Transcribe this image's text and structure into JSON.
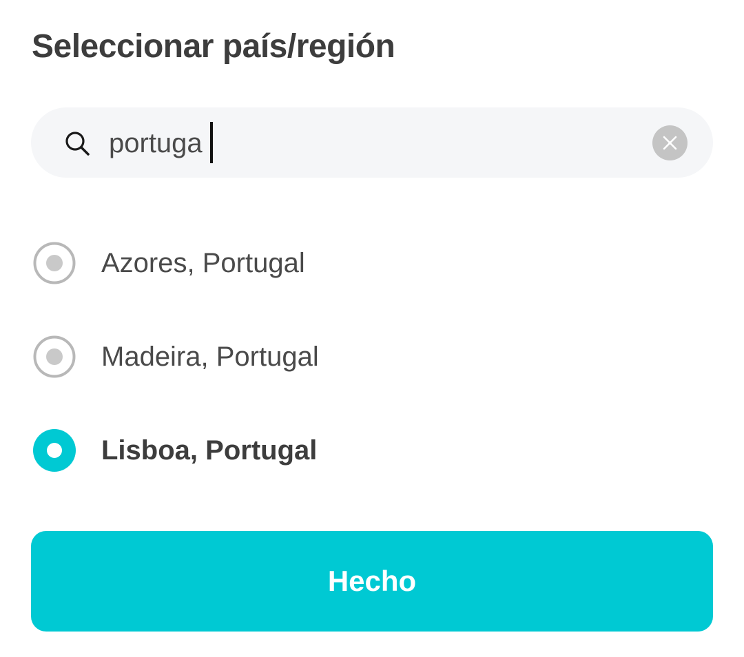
{
  "title": "Seleccionar país/región",
  "search": {
    "value": "portuga",
    "icon": "search-icon",
    "clear_icon": "close-icon"
  },
  "options": [
    {
      "label": "Azores, Portugal",
      "selected": false
    },
    {
      "label": "Madeira, Portugal",
      "selected": false
    },
    {
      "label": "Lisboa, Portugal",
      "selected": true
    }
  ],
  "done_button": {
    "label": "Hecho"
  },
  "colors": {
    "accent": "#00c9d3",
    "text": "#3d3d3d",
    "radio_inactive": "#b8b8b8",
    "search_bg": "#f5f6f8"
  }
}
